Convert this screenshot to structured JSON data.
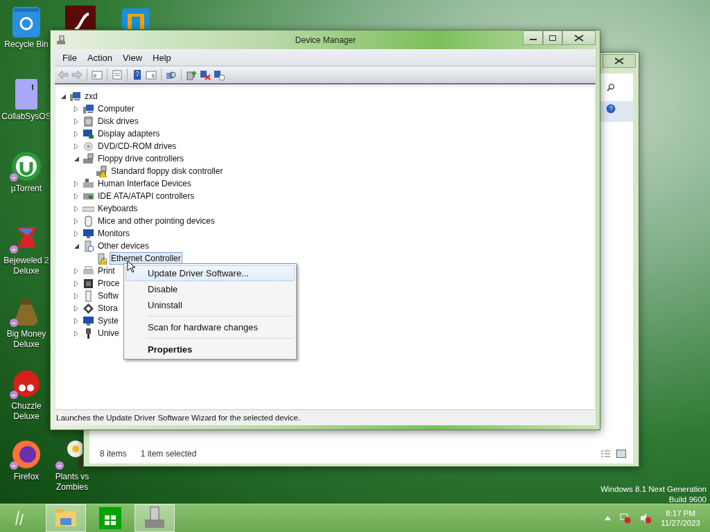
{
  "desktop_icons": [
    {
      "label": "Recycle Bin",
      "kind": "recycle",
      "shortcut": false
    },
    {
      "kind": "flash",
      "shortcut": false
    },
    {
      "kind": "vm",
      "shortcut": false
    },
    {
      "label": "CollabSysOS",
      "kind": "file",
      "shortcut": false
    },
    {
      "label": "µTorrent",
      "kind": "torrent",
      "shortcut": true
    },
    {
      "label": "Bejeweled 2 Deluxe",
      "kind": "gem",
      "shortcut": true
    },
    {
      "label": "Big Money Deluxe",
      "kind": "money",
      "shortcut": true
    },
    {
      "label": "Chuzzle Deluxe",
      "kind": "chuzzle",
      "shortcut": true
    },
    {
      "label": "Firefox",
      "kind": "firefox",
      "shortcut": true
    },
    {
      "label": "Plants vs Zombies",
      "kind": "flower",
      "shortcut": true
    }
  ],
  "back_window": {
    "status_items": [
      "8 items",
      "1 item selected"
    ]
  },
  "window": {
    "title": "Device Manager",
    "menu": [
      "File",
      "Action",
      "View",
      "Help"
    ],
    "tree": {
      "label": "zxd",
      "kind": "computer",
      "expanded": true,
      "selected": false,
      "children": [
        {
          "label": "Computer",
          "kind": "computer",
          "expanded": false,
          "selected": false
        },
        {
          "label": "Disk drives",
          "kind": "disk",
          "expanded": false,
          "selected": false
        },
        {
          "label": "Display adapters",
          "kind": "display",
          "expanded": false,
          "selected": false
        },
        {
          "label": "DVD/CD-ROM drives",
          "kind": "dvd",
          "expanded": false,
          "selected": false
        },
        {
          "label": "Floppy drive controllers",
          "kind": "floppy",
          "expanded": true,
          "selected": false,
          "children": [
            {
              "label": "Standard floppy disk controller",
              "kind": "floppy",
              "selected": false,
              "warning": true
            }
          ]
        },
        {
          "label": "Human Interface Devices",
          "kind": "hid",
          "expanded": false,
          "selected": false
        },
        {
          "label": "IDE ATA/ATAPI controllers",
          "kind": "ide",
          "expanded": false,
          "selected": false
        },
        {
          "label": "Keyboards",
          "kind": "keyboard",
          "expanded": false,
          "selected": false
        },
        {
          "label": "Mice and other pointing devices",
          "kind": "mouse",
          "expanded": false,
          "selected": false
        },
        {
          "label": "Monitors",
          "kind": "monitor",
          "expanded": false,
          "selected": false
        },
        {
          "label": "Other devices",
          "kind": "other",
          "expanded": true,
          "selected": false,
          "children": [
            {
              "label": "Ethernet Controller",
              "kind": "other",
              "selected": true,
              "warning": true
            }
          ]
        },
        {
          "label": "Print",
          "kind": "printer",
          "expanded": false,
          "selected": false
        },
        {
          "label": "Proce",
          "kind": "processor",
          "expanded": false,
          "selected": false
        },
        {
          "label": "Softw",
          "kind": "software",
          "expanded": false,
          "selected": false
        },
        {
          "label": "Stora",
          "kind": "storage",
          "expanded": false,
          "selected": false
        },
        {
          "label": "Syste",
          "kind": "monitor",
          "expanded": false,
          "selected": false
        },
        {
          "label": "Unive",
          "kind": "usb",
          "expanded": false,
          "selected": false
        }
      ]
    },
    "status_bar": "Launches the Update Driver Software Wizard for the selected device."
  },
  "context_menu": [
    {
      "kind": "item",
      "label": "Update Driver Software...",
      "selected": true,
      "default": false
    },
    {
      "kind": "item",
      "label": "Disable",
      "selected": false,
      "default": false
    },
    {
      "kind": "item",
      "label": "Uninstall",
      "selected": false,
      "default": false
    },
    {
      "kind": "separator"
    },
    {
      "kind": "item",
      "label": "Scan for hardware changes",
      "selected": false,
      "default": false
    },
    {
      "kind": "separator"
    },
    {
      "kind": "item",
      "label": "Properties",
      "selected": false,
      "default": true
    }
  ],
  "watermark_os": [
    "Windows 8.1 Next Generation",
    "Build 9600"
  ],
  "taskbar": {
    "apps": [
      {
        "kind": "folder",
        "active": true
      },
      {
        "kind": "store",
        "active": false
      },
      {
        "kind": "devmgr",
        "active": true
      }
    ],
    "time": "8:17 PM",
    "date": "11/27/2023"
  }
}
